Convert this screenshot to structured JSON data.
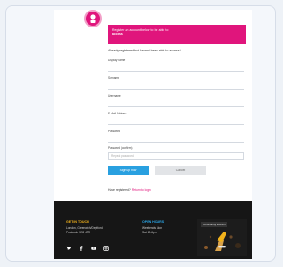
{
  "banner": {
    "line1": "Register an account below to be able to",
    "line2": "access"
  },
  "form": {
    "intro": "Already registered but haven't been able to access?",
    "fields": [
      {
        "label": "Display name",
        "value": ""
      },
      {
        "label": "Surname",
        "value": ""
      },
      {
        "label": "Username",
        "value": ""
      },
      {
        "label": "E-Mail Address",
        "value": ""
      },
      {
        "label": "Password",
        "value": ""
      }
    ],
    "password_confirm": {
      "label": "Password (confirm)",
      "placeholder": "Repeat password"
    },
    "submit_label": "Sign up now",
    "secondary_label": "Cancel",
    "login_prompt": "Have registered? ",
    "login_link": "Return to login"
  },
  "footer": {
    "col1": {
      "title": "GET IN TOUCH",
      "lines": [
        "London, Greenwich/Deptford",
        "Postcode SE8 4TR"
      ]
    },
    "col2": {
      "title": "OPEN HOURS",
      "lines": [
        "Weekends Mon",
        "Sat 10-6pm"
      ]
    },
    "promo_label": "Community kitchen",
    "social_icons": [
      "twitter-icon",
      "facebook-icon",
      "youtube-icon",
      "instagram-icon"
    ]
  },
  "colors": {
    "brand": "#e0157c",
    "primary_button": "#29a0e0",
    "footer_bg": "#161616",
    "footer_accent_1": "#f1b21b",
    "footer_accent_2": "#2aa3e3"
  }
}
